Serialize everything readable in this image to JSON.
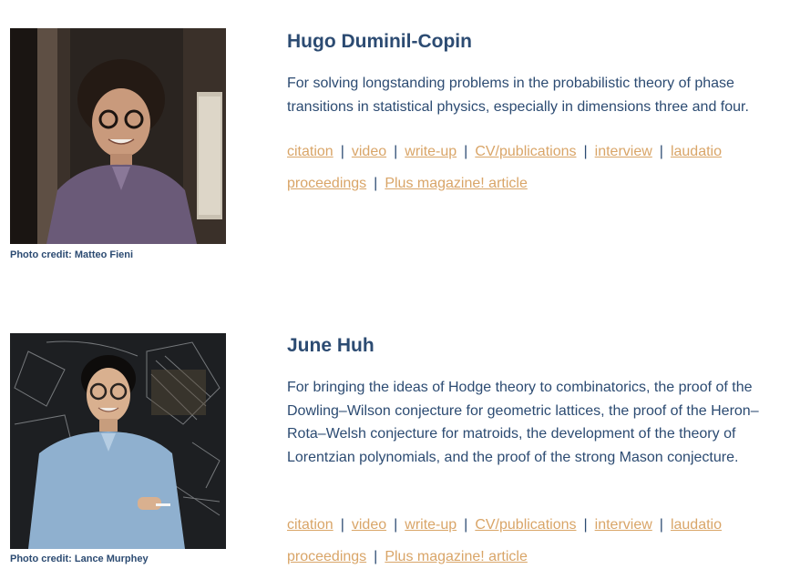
{
  "laureates": [
    {
      "name": "Hugo Duminil-Copin",
      "description": "For solving longstanding problems in the probabilistic theory of phase transitions in statistical physics, especially in dimensions three and four.",
      "photo_credit": "Photo credit: Matteo Fieni",
      "links": {
        "citation": "citation",
        "video": "video",
        "write_up": "write-up",
        "cv": "CV/publications",
        "interview": "interview",
        "laudatio": "laudatio",
        "proceedings": "proceedings",
        "plus": "Plus magazine! article"
      }
    },
    {
      "name": "June Huh",
      "description": "For bringing the ideas of Hodge theory to combinatorics, the proof of the Dowling–Wilson conjecture for geometric lattices, the proof of the Heron–Rota–Welsh conjecture for matroids, the development of the theory of Lorentzian polynomials, and the proof of the strong Mason conjecture.",
      "photo_credit": "Photo credit: Lance Murphey",
      "links": {
        "citation": "citation",
        "video": "video",
        "write_up": "write-up",
        "cv": "CV/publications",
        "interview": "interview",
        "laudatio": "laudatio",
        "proceedings": "proceedings",
        "plus": "Plus magazine! article"
      }
    }
  ],
  "separator": "|",
  "colors": {
    "text": "#2c4b72",
    "link": "#d9a568",
    "background": "#ffffff"
  }
}
